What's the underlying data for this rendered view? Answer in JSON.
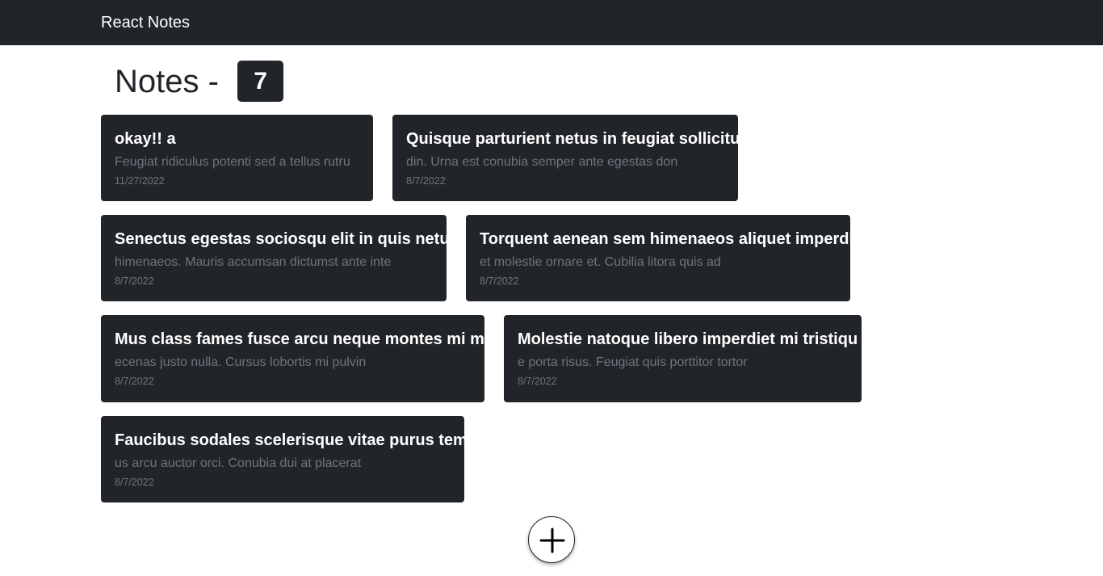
{
  "navbar": {
    "brand": "React Notes"
  },
  "header": {
    "title": "Notes - ",
    "count": "7"
  },
  "notes": [
    {
      "title": "okay!! a",
      "body": "Feugiat ridiculus potenti sed a tellus rutru",
      "date": "11/27/2022"
    },
    {
      "title": "Quisque parturient netus in feugiat sollicitu",
      "body": "din. Urna est conubia semper ante egestas don",
      "date": "8/7/2022"
    },
    {
      "title": "Senectus egestas sociosqu elit in quis netus",
      "body": "himenaeos. Mauris accumsan dictumst ante inte",
      "date": "8/7/2022"
    },
    {
      "title": "Torquent aenean sem himenaeos aliquet imperdi",
      "body": "et molestie ornare et. Cubilia litora quis ad",
      "date": "8/7/2022"
    },
    {
      "title": "Mus class fames fusce arcu neque montes mi ma",
      "body": "ecenas justo nulla. Cursus lobortis mi pulvin",
      "date": "8/7/2022"
    },
    {
      "title": "Molestie natoque libero imperdiet mi tristiqu",
      "body": "e porta risus. Feugiat quis porttitor tortor",
      "date": "8/7/2022"
    },
    {
      "title": "Faucibus sodales scelerisque vitae purus temp",
      "body": "us arcu auctor orci. Conubia dui at placerat",
      "date": "8/7/2022"
    }
  ],
  "add_button": {
    "icon": "plus-icon"
  },
  "colors": {
    "dark": "#212529",
    "muted": "#6c757d",
    "white": "#ffffff"
  }
}
